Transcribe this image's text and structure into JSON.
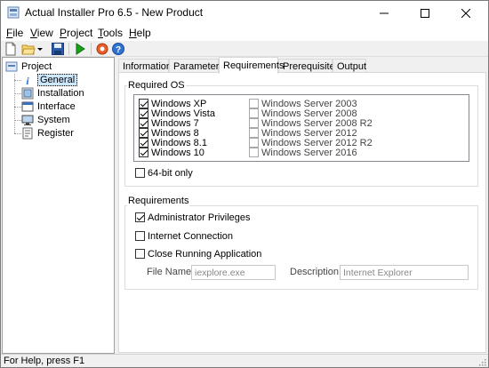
{
  "window": {
    "title": "Actual Installer Pro 6.5 - New Product"
  },
  "menu": [
    {
      "underline": "F",
      "rest": "ile"
    },
    {
      "underline": "V",
      "rest": "iew"
    },
    {
      "underline": "P",
      "rest": "roject"
    },
    {
      "underline": "T",
      "rest": "ools"
    },
    {
      "underline": "H",
      "rest": "elp"
    }
  ],
  "toolbar": {
    "icons": [
      "new-file-icon",
      "open-folder-icon",
      "dropdown-arrow-icon",
      "save-icon",
      "run-icon",
      "build-icon",
      "help-icon"
    ]
  },
  "tree": {
    "root": "Project",
    "items": [
      {
        "label": "General",
        "icon": "info-icon",
        "selected": true
      },
      {
        "label": "Installation",
        "icon": "installation-icon"
      },
      {
        "label": "Interface",
        "icon": "interface-icon"
      },
      {
        "label": "System",
        "icon": "system-icon"
      },
      {
        "label": "Register",
        "icon": "register-icon"
      }
    ]
  },
  "tabs": [
    "Information",
    "Parameters",
    "Requirements",
    "Prerequisites",
    "Output"
  ],
  "active_tab": "Requirements",
  "required_os": {
    "title": "Required OS",
    "col1": [
      {
        "label": "Windows XP",
        "checked": true
      },
      {
        "label": "Windows Vista",
        "checked": true
      },
      {
        "label": "Windows 7",
        "checked": true
      },
      {
        "label": "Windows 8",
        "checked": true
      },
      {
        "label": "Windows 8.1",
        "checked": true
      },
      {
        "label": "Windows 10",
        "checked": true
      }
    ],
    "col2": [
      {
        "label": "Windows Server 2003",
        "checked": false
      },
      {
        "label": "Windows Server 2008",
        "checked": false
      },
      {
        "label": "Windows Server 2008 R2",
        "checked": false
      },
      {
        "label": "Windows Server 2012",
        "checked": false
      },
      {
        "label": "Windows Server 2012 R2",
        "checked": false
      },
      {
        "label": "Windows Server 2016",
        "checked": false
      }
    ],
    "only64": {
      "label": "64-bit only",
      "checked": false
    }
  },
  "requirements": {
    "title": "Requirements",
    "admin": {
      "label": "Administrator Privileges",
      "checked": true
    },
    "internet": {
      "label": "Internet Connection",
      "checked": false
    },
    "close_app": {
      "label": "Close Running Application",
      "checked": false
    },
    "file_name_label": "File Name:",
    "file_name_value": "iexplore.exe",
    "description_label": "Description:",
    "description_value": "Internet Explorer"
  },
  "status": {
    "text": "For Help, press F1"
  },
  "colors": {
    "selection": "#cce8ff",
    "accent_green": "#1aa01a",
    "save_blue": "#2a5aa8"
  }
}
